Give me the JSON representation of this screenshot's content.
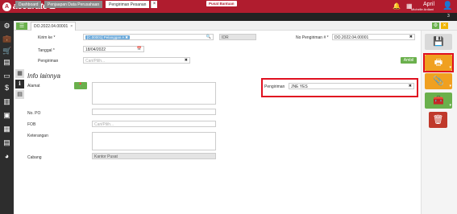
{
  "app": {
    "brand": "accurate",
    "help_badge": "Pusat Bantuan",
    "user_name": "April",
    "user_sub": "Michelle Ardiani",
    "tab_count": "3"
  },
  "tabs": [
    {
      "label": "Dashboard"
    },
    {
      "label": "Penjaapan Data Perusahaan"
    },
    {
      "label": "Pengiriman Pesanan"
    }
  ],
  "doc_tab": {
    "label": "DO.2022.04.00001",
    "close": "×"
  },
  "form": {
    "kirim_ke_label": "Kirim ke *",
    "kirim_ke_value": "[C.00001] Pelanggan A",
    "idr": "IDR",
    "no_pengiriman_label": "No Pengiriman # *",
    "no_pengiriman_value": "DO.2022.04.00001",
    "tanggal_label": "Tanggal *",
    "tanggal_value": "18/04/2022",
    "pengiriman_label": "Pengiriman",
    "pengiriman_placeholder": "Cari/Pilih...",
    "ambil_label": "Ambil"
  },
  "info": {
    "title": "Info lainnya",
    "alamat_label": "Alamat",
    "no_po_label": "No. PO",
    "fob_label": "FOB",
    "fob_placeholder": "Cari/Pilih...",
    "keterangan_label": "Keterangan",
    "cabang_label": "Cabang",
    "cabang_value": "Kantor Pusat",
    "pengiriman_label": "Pengiriman",
    "pengiriman_value": "JNE YES"
  },
  "colors": {
    "brand_red": "#b01c2e",
    "green": "#6ab04c",
    "orange": "#f0a020",
    "red_button": "#c0392b",
    "highlight": "#e01020"
  },
  "icons": {
    "sidebar": [
      "gear-icon",
      "briefcase-icon",
      "cart-icon",
      "store-icon",
      "inbox-icon",
      "money-icon",
      "bank-icon",
      "boxes-icon",
      "factory-icon",
      "table-icon",
      "pie-chart-icon"
    ],
    "right_panel": [
      "save-icon",
      "printer-icon",
      "paperclip-icon",
      "toolbox-icon",
      "trash-icon"
    ]
  }
}
